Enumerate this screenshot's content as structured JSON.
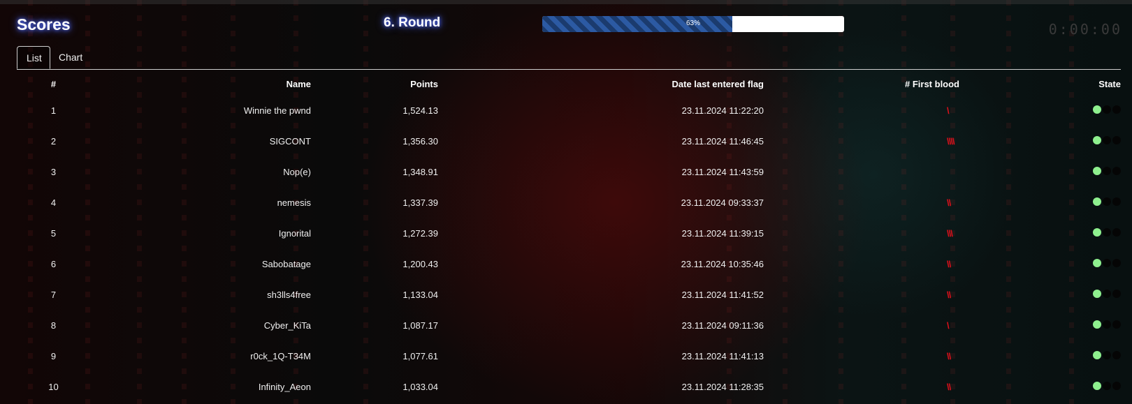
{
  "header": {
    "title": "Scores",
    "round": "6. Round",
    "progress_percent": 63,
    "progress_label": "63%",
    "timer": "0:00:00"
  },
  "tabs": [
    {
      "label": "List",
      "active": true
    },
    {
      "label": "Chart",
      "active": false
    }
  ],
  "table": {
    "columns": [
      "#",
      "Name",
      "Points",
      "Date last entered flag",
      "# First blood",
      "State"
    ],
    "rows": [
      {
        "rank": "1",
        "name": "Winnie the pwnd",
        "points": "1,524.13",
        "date": "23.11.2024 11:22:20",
        "first_blood": "\\",
        "state": "online"
      },
      {
        "rank": "2",
        "name": "SIGCONT",
        "points": "1,356.30",
        "date": "23.11.2024 11:46:45",
        "first_blood": "\\\\\\\\",
        "state": "online"
      },
      {
        "rank": "3",
        "name": "Nop(e)",
        "points": "1,348.91",
        "date": "23.11.2024 11:43:59",
        "first_blood": "",
        "state": "online"
      },
      {
        "rank": "4",
        "name": "nemesis",
        "points": "1,337.39",
        "date": "23.11.2024 09:33:37",
        "first_blood": "\\\\",
        "state": "online"
      },
      {
        "rank": "5",
        "name": "Ignorital",
        "points": "1,272.39",
        "date": "23.11.2024 11:39:15",
        "first_blood": "\\\\\\",
        "state": "online"
      },
      {
        "rank": "6",
        "name": "Sabobatage",
        "points": "1,200.43",
        "date": "23.11.2024 10:35:46",
        "first_blood": "\\\\",
        "state": "online"
      },
      {
        "rank": "7",
        "name": "sh3lls4free",
        "points": "1,133.04",
        "date": "23.11.2024 11:41:52",
        "first_blood": "\\\\",
        "state": "online"
      },
      {
        "rank": "8",
        "name": "Cyber_KiTa",
        "points": "1,087.17",
        "date": "23.11.2024 09:11:36",
        "first_blood": "\\",
        "state": "online"
      },
      {
        "rank": "9",
        "name": "r0ck_1Q-T34M",
        "points": "1,077.61",
        "date": "23.11.2024 11:41:13",
        "first_blood": "\\\\",
        "state": "online"
      },
      {
        "rank": "10",
        "name": "Infinity_Aeon",
        "points": "1,033.04",
        "date": "23.11.2024 11:28:35",
        "first_blood": "\\\\",
        "state": "online"
      }
    ]
  },
  "colors": {
    "accent_glow": "#4f6bff",
    "first_blood": "#e0101b",
    "state_online": "#8ef08e",
    "progress_fill": "#1b3b6e"
  }
}
